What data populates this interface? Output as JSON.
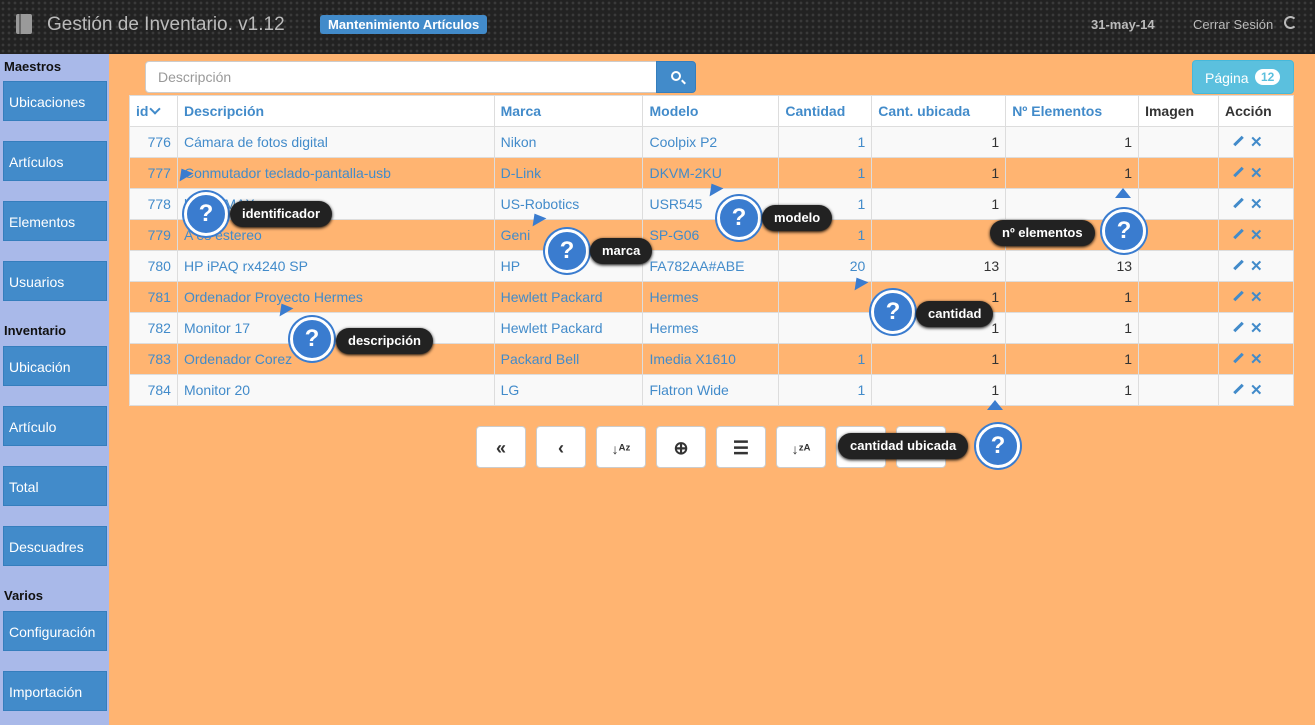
{
  "header": {
    "title": "Gestión de Inventario. v1.12",
    "module": "Mantenimiento Artículos",
    "date": "31-may-14",
    "logout": "Cerrar Sesión"
  },
  "sidebar": {
    "sections": [
      {
        "title": "Maestros",
        "items": [
          "Ubicaciones",
          "Artículos",
          "Elementos",
          "Usuarios"
        ]
      },
      {
        "title": "Inventario",
        "items": [
          "Ubicación",
          "Artículo",
          "Total",
          "Descuadres"
        ]
      },
      {
        "title": "Varios",
        "items": [
          "Configuración",
          "Importación"
        ]
      }
    ]
  },
  "search": {
    "placeholder": "Descripción",
    "value": ""
  },
  "pagination": {
    "label": "Página",
    "count": "12"
  },
  "table": {
    "columns": [
      "id",
      "Descripción",
      "Marca",
      "Modelo",
      "Cantidad",
      "Cant. ubicada",
      "Nº Elementos",
      "Imagen",
      "Acción"
    ],
    "rows": [
      {
        "id": "776",
        "desc": "Cámara de fotos digital",
        "marca": "Nikon",
        "modelo": "Coolpix P2",
        "cantidad": "1",
        "ubicada": "1",
        "elementos": "1"
      },
      {
        "id": "777",
        "desc": "Conmutador teclado-pantalla-usb",
        "marca": "D-Link",
        "modelo": "DKVM-2KU",
        "cantidad": "1",
        "ubicada": "1",
        "elementos": "1"
      },
      {
        "id": "778",
        "desc": "botics MAXg",
        "marca": "US-Robotics",
        "modelo": "USR545",
        "cantidad": "1",
        "ubicada": "1",
        "elementos": ""
      },
      {
        "id": "779",
        "desc": "A     es estereo",
        "marca": "Geni",
        "modelo": "SP-G06",
        "cantidad": "1",
        "ubicada": "",
        "elementos": ""
      },
      {
        "id": "780",
        "desc": "HP iPAQ rx4240 SP",
        "marca": "HP",
        "modelo": "FA782AA#ABE",
        "cantidad": "20",
        "ubicada": "13",
        "elementos": "13"
      },
      {
        "id": "781",
        "desc": "Ordenador Proyecto Hermes",
        "marca": "Hewlett Packard",
        "modelo": "Hermes",
        "cantidad": "",
        "ubicada": "1",
        "elementos": "1"
      },
      {
        "id": "782",
        "desc": "Monitor 17",
        "marca": "Hewlett Packard",
        "modelo": "Hermes",
        "cantidad": "",
        "ubicada": "1",
        "elementos": "1"
      },
      {
        "id": "783",
        "desc": "Ordenador Corez",
        "marca": "Packard Bell",
        "modelo": "Imedia X1610",
        "cantidad": "1",
        "ubicada": "1",
        "elementos": "1"
      },
      {
        "id": "784",
        "desc": "Monitor 20",
        "marca": "LG",
        "modelo": "Flatron Wide",
        "cantidad": "1",
        "ubicada": "1",
        "elementos": "1"
      }
    ]
  },
  "help": {
    "identificador": "identificador",
    "marca": "marca",
    "modelo": "modelo",
    "elementos": "nº elementos",
    "cantidad": "cantidad",
    "descripcion": "descripción",
    "cantidad_ubicada": "cantidad ubicada",
    "glyph": "?"
  },
  "toolbar": [
    "first-icon",
    "prev-icon",
    "sort-az-icon",
    "add-icon",
    "list-icon",
    "sort-za-icon"
  ],
  "colors": {
    "accent": "#428bca",
    "background": "#ffb471",
    "sidebar": "#a9b9e9"
  }
}
